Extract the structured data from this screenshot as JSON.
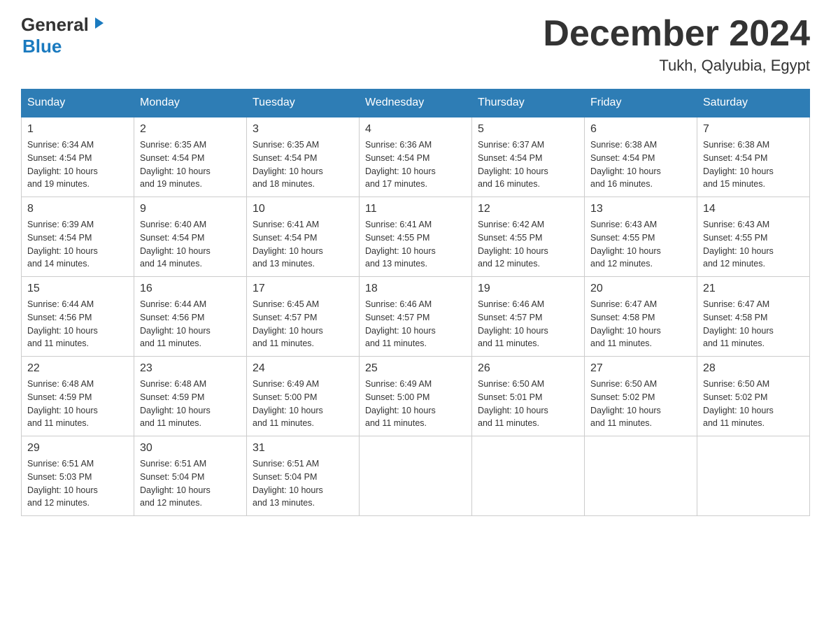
{
  "header": {
    "logo": {
      "general": "General",
      "blue": "Blue"
    },
    "title": "December 2024",
    "location": "Tukh, Qalyubia, Egypt"
  },
  "weekdays": [
    "Sunday",
    "Monday",
    "Tuesday",
    "Wednesday",
    "Thursday",
    "Friday",
    "Saturday"
  ],
  "weeks": [
    [
      {
        "day": "1",
        "sunrise": "6:34 AM",
        "sunset": "4:54 PM",
        "daylight": "10 hours and 19 minutes."
      },
      {
        "day": "2",
        "sunrise": "6:35 AM",
        "sunset": "4:54 PM",
        "daylight": "10 hours and 19 minutes."
      },
      {
        "day": "3",
        "sunrise": "6:35 AM",
        "sunset": "4:54 PM",
        "daylight": "10 hours and 18 minutes."
      },
      {
        "day": "4",
        "sunrise": "6:36 AM",
        "sunset": "4:54 PM",
        "daylight": "10 hours and 17 minutes."
      },
      {
        "day": "5",
        "sunrise": "6:37 AM",
        "sunset": "4:54 PM",
        "daylight": "10 hours and 16 minutes."
      },
      {
        "day": "6",
        "sunrise": "6:38 AM",
        "sunset": "4:54 PM",
        "daylight": "10 hours and 16 minutes."
      },
      {
        "day": "7",
        "sunrise": "6:38 AM",
        "sunset": "4:54 PM",
        "daylight": "10 hours and 15 minutes."
      }
    ],
    [
      {
        "day": "8",
        "sunrise": "6:39 AM",
        "sunset": "4:54 PM",
        "daylight": "10 hours and 14 minutes."
      },
      {
        "day": "9",
        "sunrise": "6:40 AM",
        "sunset": "4:54 PM",
        "daylight": "10 hours and 14 minutes."
      },
      {
        "day": "10",
        "sunrise": "6:41 AM",
        "sunset": "4:54 PM",
        "daylight": "10 hours and 13 minutes."
      },
      {
        "day": "11",
        "sunrise": "6:41 AM",
        "sunset": "4:55 PM",
        "daylight": "10 hours and 13 minutes."
      },
      {
        "day": "12",
        "sunrise": "6:42 AM",
        "sunset": "4:55 PM",
        "daylight": "10 hours and 12 minutes."
      },
      {
        "day": "13",
        "sunrise": "6:43 AM",
        "sunset": "4:55 PM",
        "daylight": "10 hours and 12 minutes."
      },
      {
        "day": "14",
        "sunrise": "6:43 AM",
        "sunset": "4:55 PM",
        "daylight": "10 hours and 12 minutes."
      }
    ],
    [
      {
        "day": "15",
        "sunrise": "6:44 AM",
        "sunset": "4:56 PM",
        "daylight": "10 hours and 11 minutes."
      },
      {
        "day": "16",
        "sunrise": "6:44 AM",
        "sunset": "4:56 PM",
        "daylight": "10 hours and 11 minutes."
      },
      {
        "day": "17",
        "sunrise": "6:45 AM",
        "sunset": "4:57 PM",
        "daylight": "10 hours and 11 minutes."
      },
      {
        "day": "18",
        "sunrise": "6:46 AM",
        "sunset": "4:57 PM",
        "daylight": "10 hours and 11 minutes."
      },
      {
        "day": "19",
        "sunrise": "6:46 AM",
        "sunset": "4:57 PM",
        "daylight": "10 hours and 11 minutes."
      },
      {
        "day": "20",
        "sunrise": "6:47 AM",
        "sunset": "4:58 PM",
        "daylight": "10 hours and 11 minutes."
      },
      {
        "day": "21",
        "sunrise": "6:47 AM",
        "sunset": "4:58 PM",
        "daylight": "10 hours and 11 minutes."
      }
    ],
    [
      {
        "day": "22",
        "sunrise": "6:48 AM",
        "sunset": "4:59 PM",
        "daylight": "10 hours and 11 minutes."
      },
      {
        "day": "23",
        "sunrise": "6:48 AM",
        "sunset": "4:59 PM",
        "daylight": "10 hours and 11 minutes."
      },
      {
        "day": "24",
        "sunrise": "6:49 AM",
        "sunset": "5:00 PM",
        "daylight": "10 hours and 11 minutes."
      },
      {
        "day": "25",
        "sunrise": "6:49 AM",
        "sunset": "5:00 PM",
        "daylight": "10 hours and 11 minutes."
      },
      {
        "day": "26",
        "sunrise": "6:50 AM",
        "sunset": "5:01 PM",
        "daylight": "10 hours and 11 minutes."
      },
      {
        "day": "27",
        "sunrise": "6:50 AM",
        "sunset": "5:02 PM",
        "daylight": "10 hours and 11 minutes."
      },
      {
        "day": "28",
        "sunrise": "6:50 AM",
        "sunset": "5:02 PM",
        "daylight": "10 hours and 11 minutes."
      }
    ],
    [
      {
        "day": "29",
        "sunrise": "6:51 AM",
        "sunset": "5:03 PM",
        "daylight": "10 hours and 12 minutes."
      },
      {
        "day": "30",
        "sunrise": "6:51 AM",
        "sunset": "5:04 PM",
        "daylight": "10 hours and 12 minutes."
      },
      {
        "day": "31",
        "sunrise": "6:51 AM",
        "sunset": "5:04 PM",
        "daylight": "10 hours and 13 minutes."
      },
      null,
      null,
      null,
      null
    ]
  ],
  "labels": {
    "sunrise_prefix": "Sunrise: ",
    "sunset_prefix": "Sunset: ",
    "daylight_prefix": "Daylight: "
  }
}
